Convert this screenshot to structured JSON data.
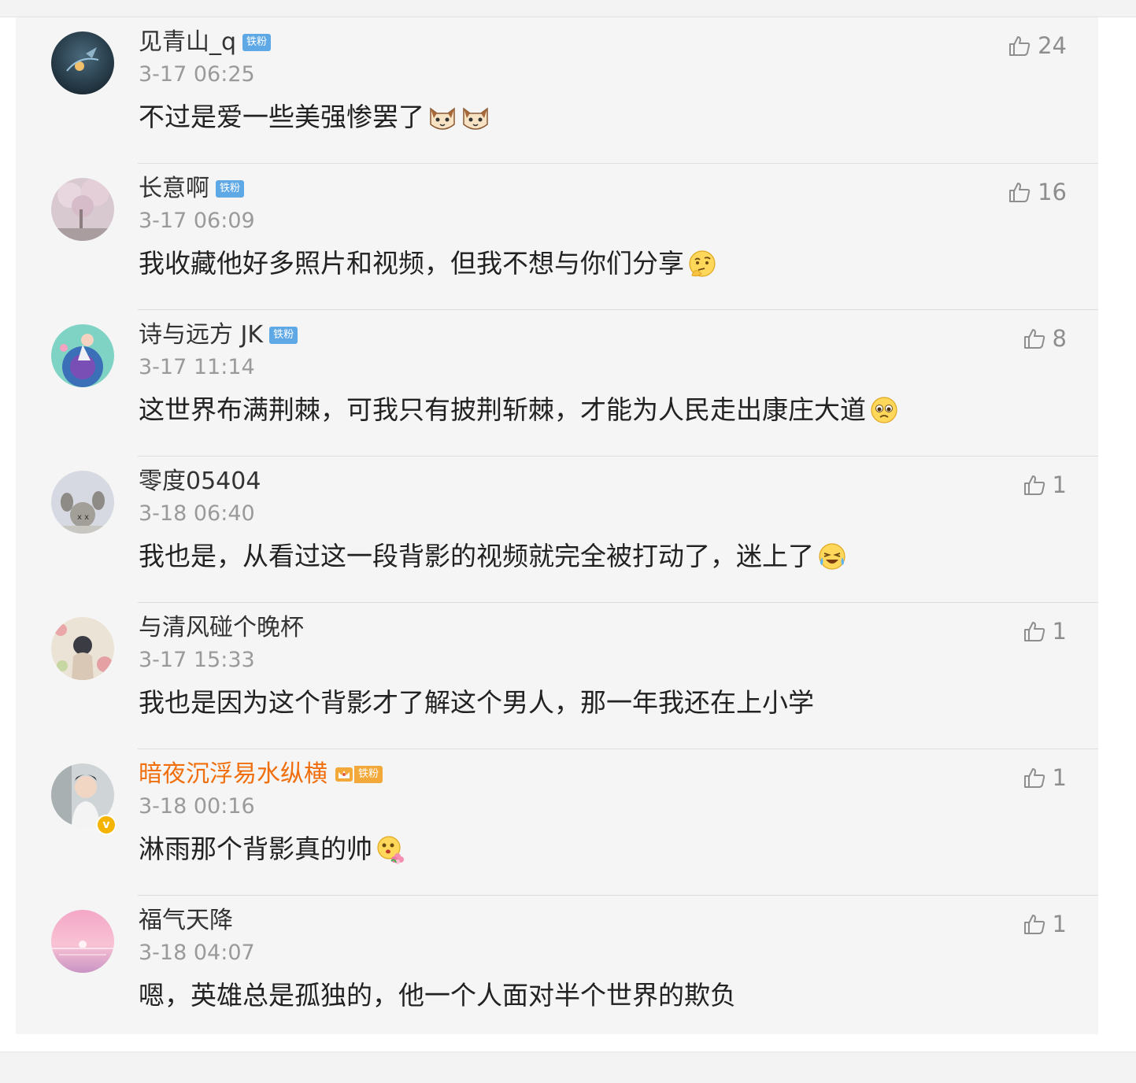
{
  "comments": [
    {
      "username": "见青山_q",
      "badge": "铁粉",
      "time": "3-17 06:25",
      "text": "不过是爱一些美强惨罢了",
      "emojis": [
        "cat-face-icon",
        "cat-face-icon"
      ],
      "likes": "24"
    },
    {
      "username": "长意啊",
      "badge": "铁粉",
      "time": "3-17 06:09",
      "text": "我收藏他好多照片和视频，但我不想与你们分享",
      "emojis": [
        "thinking-face-icon"
      ],
      "likes": "16"
    },
    {
      "username": "诗与远方 JK",
      "badge": "铁粉",
      "time": "3-17 11:14",
      "text": "这世界布满荆棘，可我只有披荆斩棘，才能为人民走出康庄大道",
      "emojis": [
        "pleading-face-icon"
      ],
      "likes": "8"
    },
    {
      "username": "零度05404",
      "time": "3-18 06:40",
      "text": "我也是，从看过这一段背影的视频就完全被打动了，迷上了",
      "emojis": [
        "laughing-crying-face-icon"
      ],
      "likes": "1"
    },
    {
      "username": "与清风碰个晚杯",
      "time": "3-17 15:33",
      "text": "我也是因为这个背影才了解这个男人，那一年我还在上小学",
      "likes": "1"
    },
    {
      "username": "暗夜沉浮易水纵横",
      "badge": "铁粉",
      "vip": true,
      "verified": true,
      "time": "3-18 00:16",
      "text": "淋雨那个背影真的帅",
      "emojis": [
        "flower-face-icon"
      ],
      "likes": "1"
    },
    {
      "username": "福气天降",
      "time": "3-18 04:07",
      "text": "嗯，英雄总是孤独的，他一个人面对半个世界的欺负",
      "likes": "1"
    }
  ],
  "colors": {
    "vip_name": "#f06e0c",
    "fan_badge": "#5fa8e6",
    "verified": "#f5b400"
  }
}
